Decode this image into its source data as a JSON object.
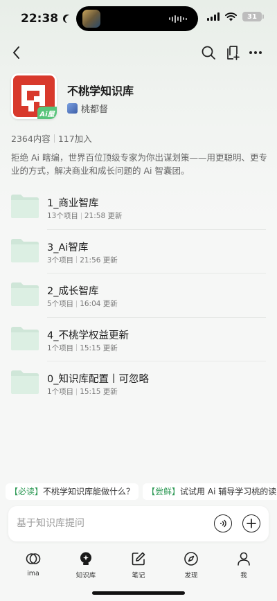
{
  "status_bar": {
    "time": "22:38",
    "battery": "31"
  },
  "nav": {
    "back_icon": "chevron-left-icon",
    "search_icon": "search-icon",
    "add_icon": "add-to-collection-icon",
    "more_icon": "more-icon"
  },
  "kb": {
    "title": "不桃学知识库",
    "owner": "桃都督",
    "logo_badge": "Ai屋",
    "content_count": "2364内容",
    "join_count": "117加入",
    "description": "拒绝 Ai 瞎编，世界百位顶级专家为你出谋划策——用更聪明、更专业的方式，解决商业和成长问题的 Ai 智囊团。",
    "accent_red": "#d8392c",
    "accent_green": "#58c47a"
  },
  "folders": [
    {
      "name": "1_商业智库",
      "items": "13个项目",
      "updated": "21:58 更新"
    },
    {
      "name": "3_Ai智库",
      "items": "3个项目",
      "updated": "21:56 更新"
    },
    {
      "name": "2_成长智库",
      "items": "5个项目",
      "updated": "16:04 更新"
    },
    {
      "name": "4_不桃学权益更新",
      "items": "1个项目",
      "updated": "15:15 更新"
    },
    {
      "name": "0_知识库配置丨可忽略",
      "items": "1个项目",
      "updated": "15:15 更新"
    }
  ],
  "suggestions": [
    {
      "tag": "【必读】",
      "text": "不桃学知识库能做什么？"
    },
    {
      "tag": "【尝鲜】",
      "text": "试试用 Ai 辅导学习桃的读"
    }
  ],
  "ask": {
    "placeholder": "基于知识库提问"
  },
  "tabs": [
    {
      "label": "ima",
      "icon": "ima-logo-icon"
    },
    {
      "label": "知识库",
      "icon": "knowledge-base-icon"
    },
    {
      "label": "笔记",
      "icon": "note-edit-icon"
    },
    {
      "label": "发现",
      "icon": "compass-icon"
    },
    {
      "label": "我",
      "icon": "person-icon"
    }
  ]
}
